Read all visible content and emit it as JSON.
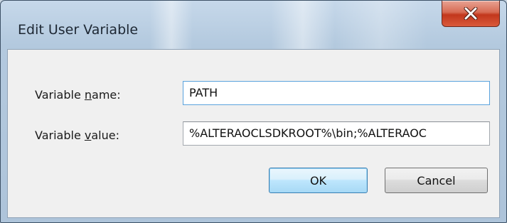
{
  "window": {
    "title": "Edit User Variable",
    "close_icon": "close-x-icon"
  },
  "form": {
    "name_label_pre": "Variable ",
    "name_label_accel": "n",
    "name_label_post": "ame:",
    "name_value": "PATH",
    "value_label_pre": "Variable ",
    "value_label_accel": "v",
    "value_label_post": "alue:",
    "value_value": "%ALTERAOCLSDKROOT%\\bin;%ALTERAOC"
  },
  "buttons": {
    "ok_label": "OK",
    "cancel_label": "Cancel"
  },
  "colors": {
    "close_button": "#c2371c",
    "default_button_border": "#3c7fb1",
    "field_focus": "#5aa2dd"
  }
}
